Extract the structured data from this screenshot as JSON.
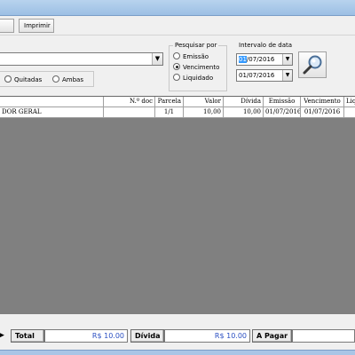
{
  "toolbar": {
    "first_label": "",
    "print_label": "Imprimir"
  },
  "filter": {
    "client_value": "",
    "status_options": [
      {
        "label": "",
        "selected": false
      },
      {
        "label": "Quitadas",
        "selected": false
      },
      {
        "label": "Ambas",
        "selected": false
      }
    ],
    "search_by": {
      "legend": "Pesquisar por",
      "options": [
        {
          "label": "Emissão",
          "selected": false
        },
        {
          "label": "Vencimento",
          "selected": true
        },
        {
          "label": "Liquidado",
          "selected": false
        }
      ]
    },
    "date_range": {
      "legend": "Intervalo de data",
      "start_day": "01",
      "start_rest": "/07/2016",
      "end": "01/07/2016"
    }
  },
  "grid": {
    "columns": [
      "",
      "N.º doc",
      "Parcela",
      "Valor",
      "Dívida",
      "Emissão",
      "Vencimento",
      "Liq"
    ],
    "rows": [
      {
        "name": "DOR GERAL",
        "doc": "",
        "parcela": "1/1",
        "valor": "10,00",
        "divida": "10,00",
        "emissao": "01/07/2016",
        "vencimento": "01/07/2016",
        "liq": ""
      }
    ]
  },
  "totals": {
    "total_label": "Total",
    "total_value": "R$ 10.00",
    "divida_label": "Dívida",
    "divida_value": "R$ 10.00",
    "apagar_label": "A Pagar",
    "apagar_value": ""
  },
  "colors": {
    "grid_background": "#808080",
    "value_text": "#2a4fc2",
    "selection": "#3399ff"
  },
  "icons": {
    "search": "magnifier-icon",
    "dropdown": "chevron-down-icon",
    "row_pointer": "triangle-right-icon"
  }
}
